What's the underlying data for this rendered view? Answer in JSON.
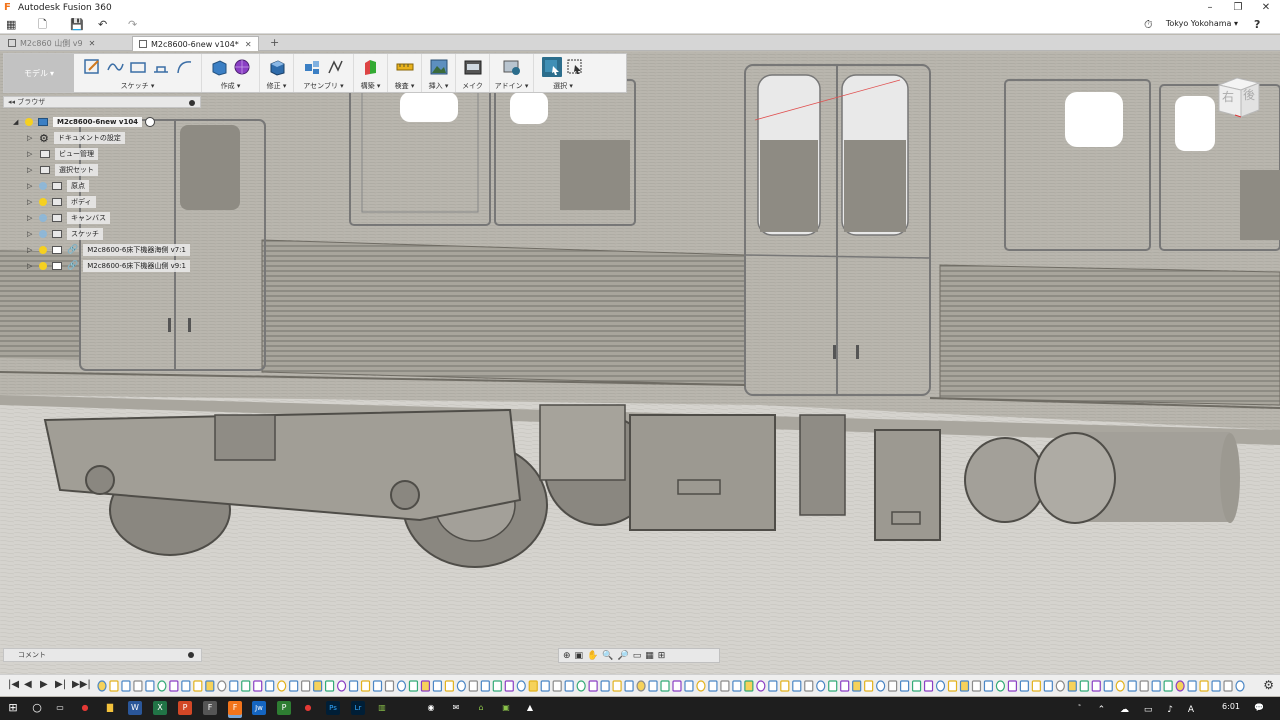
{
  "window": {
    "title": "Autodesk Fusion 360",
    "logo_icon": "fusion-logo-icon",
    "controls": [
      "–",
      "❐",
      "✕"
    ]
  },
  "qat": {
    "grid_icon": "▦",
    "file_icon": "🗋",
    "save_icon": "💾",
    "undo_icon": "↶",
    "redo_icon": "↷",
    "user": "Tokyo Yokohama ▾",
    "help_icon": "?",
    "clock_icon": "⏱"
  },
  "tabs": [
    {
      "label": "M2c860  山側 v9",
      "active": false
    },
    {
      "label": "M2c8600-6new v104*",
      "active": true
    }
  ],
  "toolbar": {
    "mode": "モデル",
    "groups": [
      {
        "label": "スケッチ ▾",
        "icons": [
          "sketch-create-icon",
          "spline-icon",
          "rectangle-icon",
          "extrude-profile-icon",
          "arc-icon"
        ]
      },
      {
        "label": "作成 ▾",
        "icons": [
          "box-create-icon",
          "form-icon"
        ]
      },
      {
        "label": "修正 ▾",
        "icons": [
          "press-pull-icon"
        ]
      },
      {
        "label": "アセンブリ ▾",
        "icons": [
          "new-component-icon",
          "joint-icon"
        ]
      },
      {
        "label": "構築 ▾",
        "icons": [
          "plane-icon"
        ]
      },
      {
        "label": "検査 ▾",
        "icons": [
          "measure-icon"
        ]
      },
      {
        "label": "挿入 ▾",
        "icons": [
          "insert-image-icon"
        ]
      },
      {
        "label": "メイク",
        "icons": [
          "make-3dprint-icon"
        ]
      },
      {
        "label": "アドイン ▾",
        "icons": [
          "addin-icon"
        ]
      },
      {
        "label": "選択 ▾",
        "icons": [
          "select-icon",
          "window-select-icon"
        ]
      }
    ]
  },
  "browser": {
    "title": "ブラウザ",
    "root": "M2c8600-6new v104",
    "items": [
      {
        "label": "ドキュメントの設定",
        "icon": "gear-icon"
      },
      {
        "label": "ビュー管理",
        "icon": "folder-icon"
      },
      {
        "label": "選択セット",
        "icon": "folder-icon"
      },
      {
        "label": "原点",
        "icon": "folder-icon"
      },
      {
        "label": "ボディ",
        "icon": "folder-icon"
      },
      {
        "label": "キャンバス",
        "icon": "folder-icon"
      },
      {
        "label": "スケッチ",
        "icon": "folder-icon"
      },
      {
        "label": "M2c8600-6床下機器海側 v7:1",
        "icon": "link-icon"
      },
      {
        "label": "M2c8600-6床下機器山側 v9:1",
        "icon": "link-icon"
      }
    ]
  },
  "viewcube": {
    "right": "右",
    "back": "後"
  },
  "comment": {
    "label": "コメント"
  },
  "navbar": {
    "icons": [
      "⊕",
      "▣",
      "✋",
      "🔍",
      "🔎",
      "▭",
      "▦",
      "⊞"
    ]
  },
  "timeline": {
    "controls": [
      "|◀",
      "◀",
      "▶",
      "▶|",
      "▶▶|"
    ],
    "feature_count": 96,
    "settings_icon": "⚙"
  },
  "taskbar": {
    "apps": [
      "⊞",
      "○",
      "▭",
      "●",
      "▇",
      "W",
      "X",
      "P",
      "F",
      "F",
      "Jw",
      "P",
      "●",
      "Ps",
      "Lr",
      "▥",
      "◉",
      "✉",
      "⌂",
      "▣",
      "▲"
    ],
    "tray": "ﾞ ⌃ ☁ ▭ ♪ A",
    "time": "6:01",
    "notification_icon": "💬"
  },
  "colors": {
    "accent": "#2b6d8c",
    "fusion_orange": "#f2741b",
    "bulb": "#f5d020",
    "bulb_off": "#8fb7d6"
  }
}
